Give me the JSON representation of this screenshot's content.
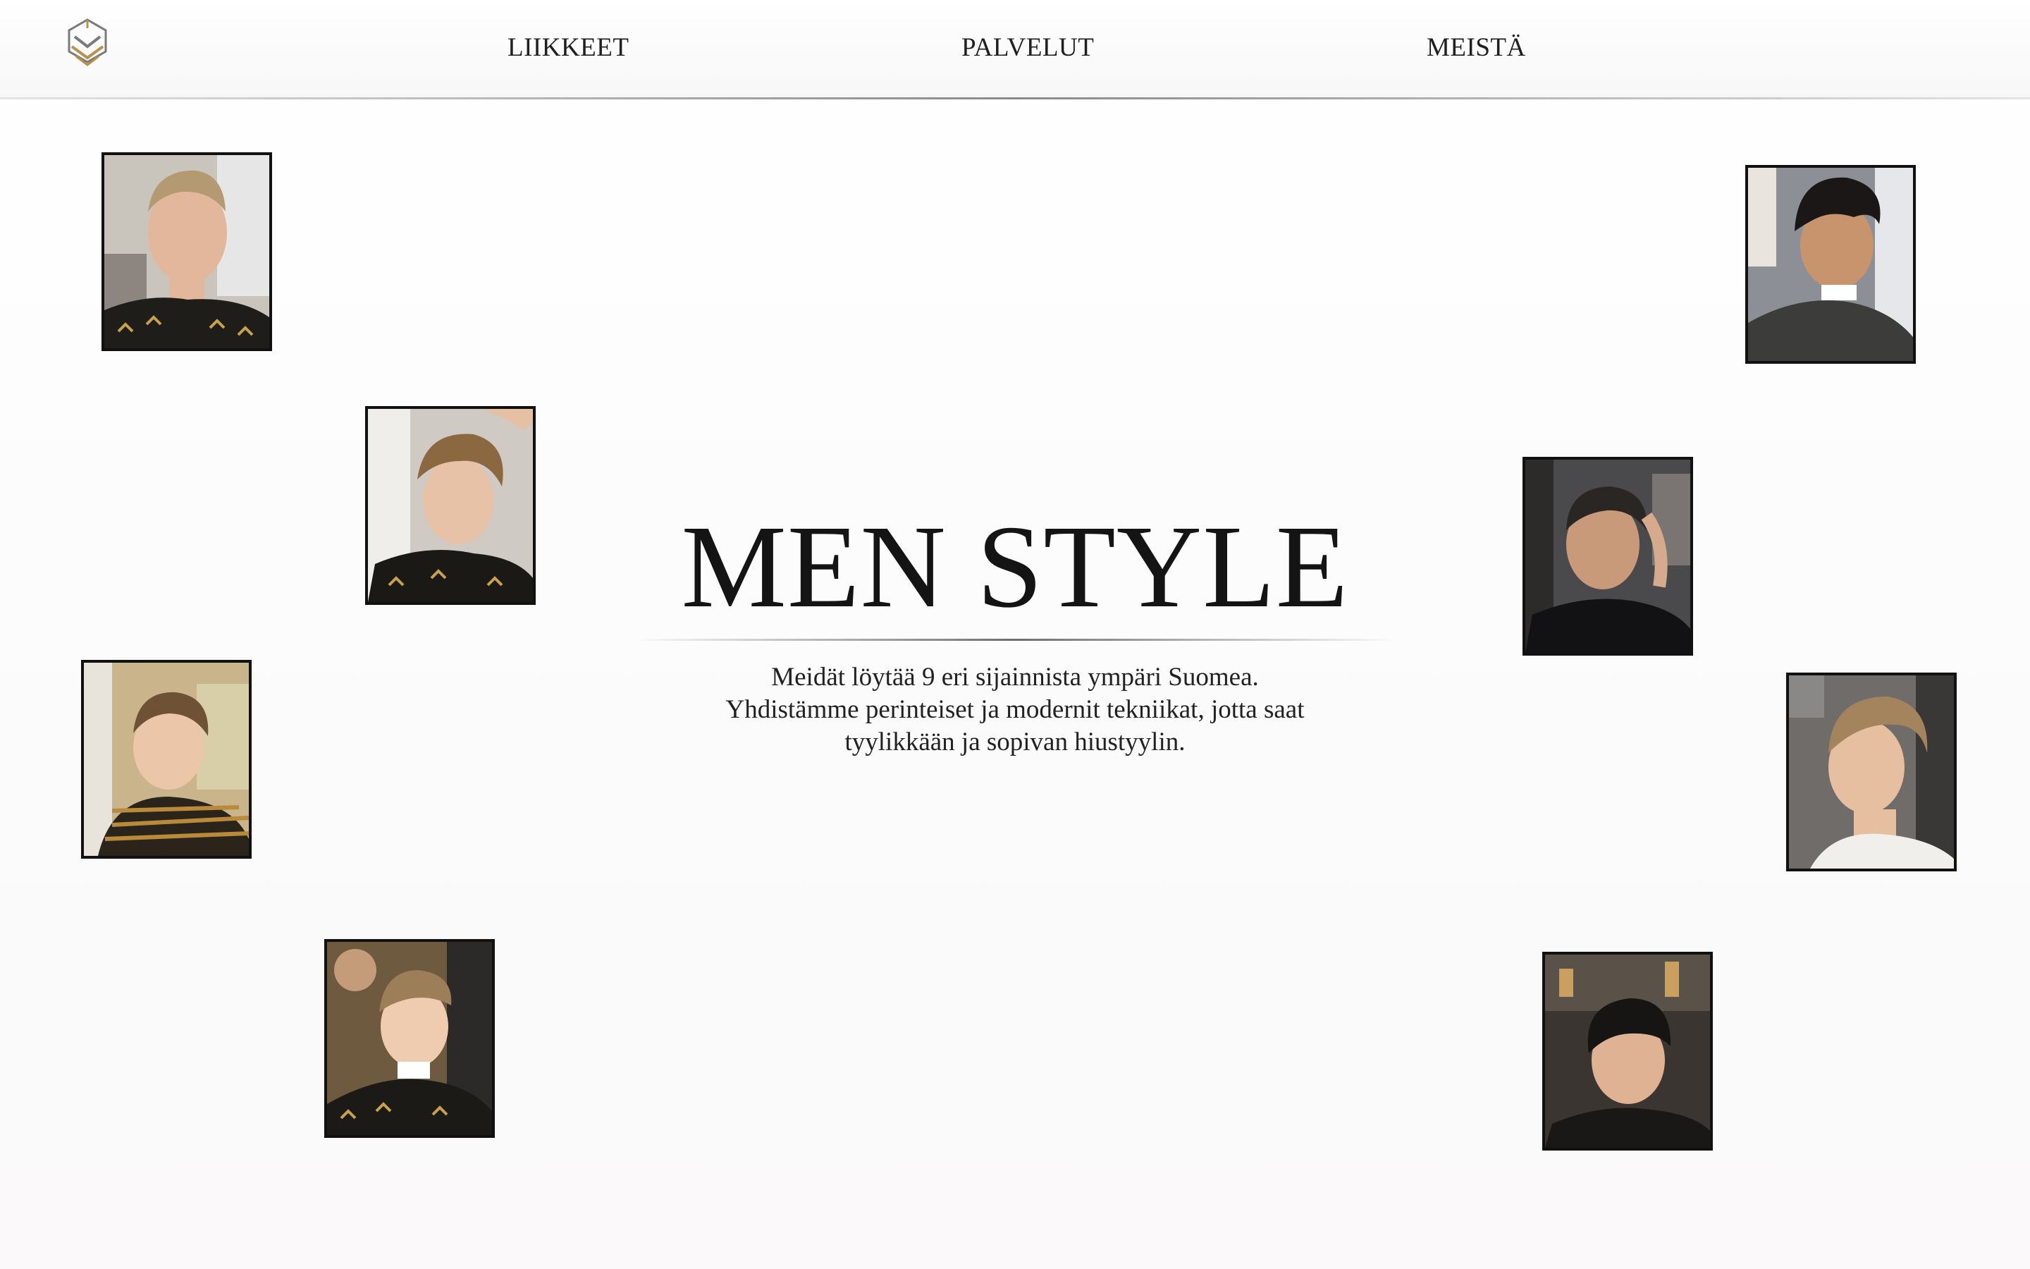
{
  "header": {
    "logo_icon": "ms-monogram-logo-icon",
    "nav": [
      {
        "label": "LIIKKEET"
      },
      {
        "label": "PALVELUT"
      },
      {
        "label": "MEISTÄ"
      }
    ]
  },
  "hero": {
    "title": "MEN STYLE",
    "lines": [
      "Meidät löytää 9 eri sijainnista ympäri Suomea.",
      "Yhdistämme perinteiset ja modernit tekniikat, jotta saat",
      "tyylikkään ja sopivan hiustyylin."
    ]
  },
  "gallery": {
    "count": 8
  },
  "colors": {
    "text": "#1a1a1a",
    "logo_gold": "#b8924a",
    "logo_grey": "#7a7a7a",
    "frame": "#111111"
  }
}
